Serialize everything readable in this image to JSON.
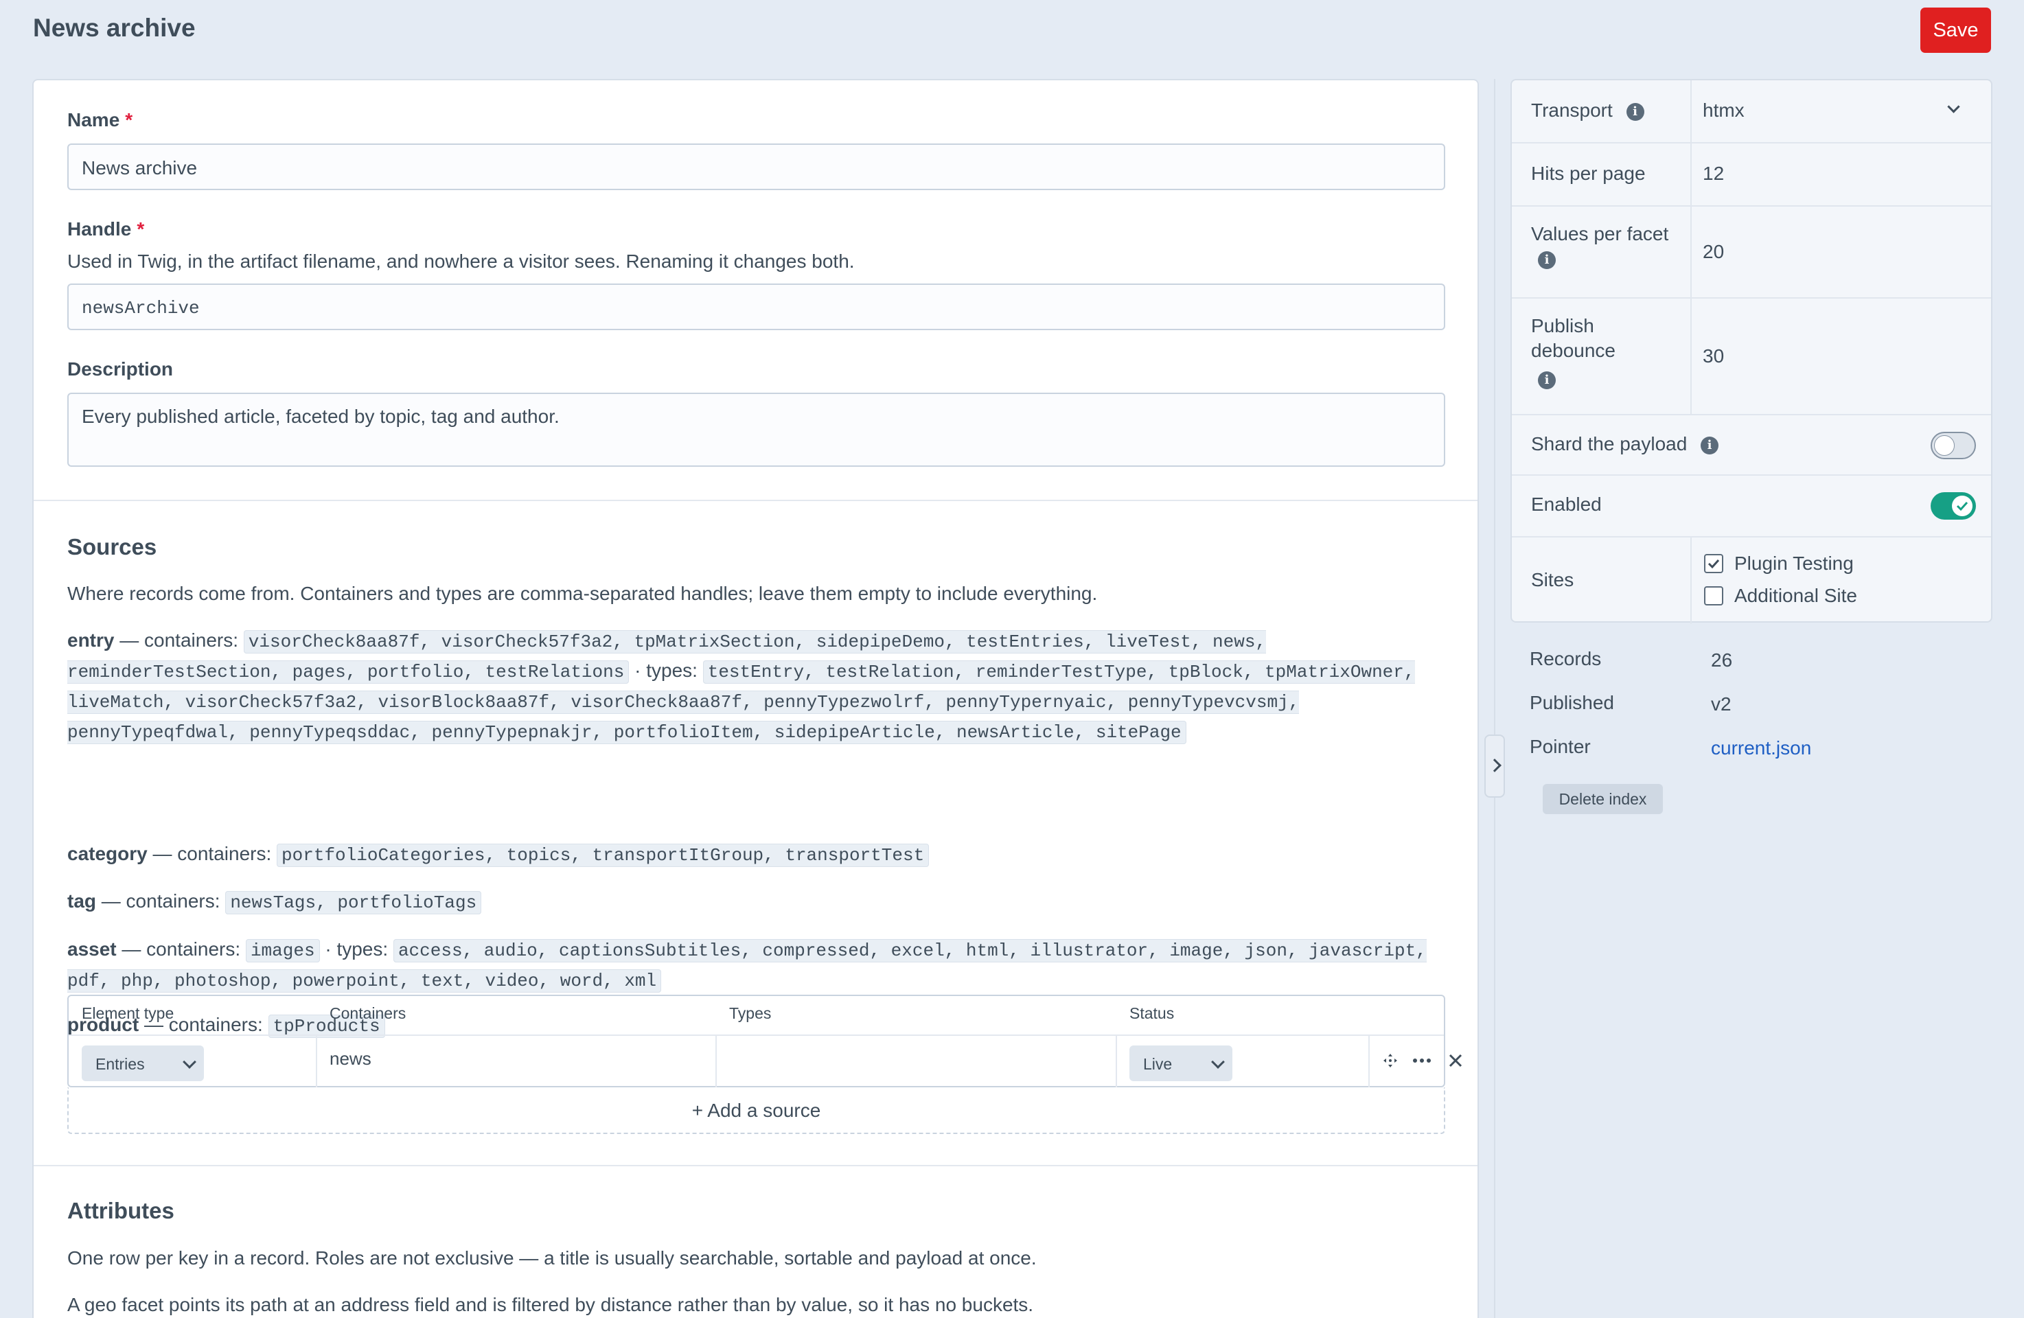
{
  "page": {
    "title": "News archive",
    "save_label": "Save"
  },
  "form": {
    "name_label": "Name",
    "name_value": "News archive",
    "handle_label": "Handle",
    "handle_help": "Used in Twig, in the artifact filename, and nowhere a visitor sees. Renaming it changes both.",
    "handle_value": "newsArchive",
    "description_label": "Description",
    "description_value": "Every published article, faceted by topic, tag and author.",
    "required_mark": "*"
  },
  "sources": {
    "heading": "Sources",
    "intro": "Where records come from. Containers and types are comma-separated handles; leave them empty to include everything.",
    "containers_text": "— containers:",
    "types_text": "· types:",
    "entry": {
      "name": "entry",
      "containers": "visorCheck8aa87f, visorCheck57f3a2, tpMatrixSection, sidepipeDemo, testEntries, liveTest, news, reminderTestSection, pages, portfolio, testRelations",
      "types": "testEntry, testRelation, reminderTestType, tpBlock, tpMatrixOwner, liveMatch, visorCheck57f3a2, visorBlock8aa87f, visorCheck8aa87f, pennyTypezwolrf, pennyTypernyaic, pennyTypevcvsmj, pennyTypeqfdwal, pennyTypeqsddac, pennyTypepnakjr, portfolioItem, sidepipeArticle, newsArticle, sitePage"
    },
    "category": {
      "name": "category",
      "containers": "portfolioCategories, topics, transportItGroup, transportTest"
    },
    "tag": {
      "name": "tag",
      "containers": "newsTags, portfolioTags"
    },
    "asset": {
      "name": "asset",
      "containers": "images",
      "types": "access, audio, captionsSubtitles, compressed, excel, html, illustrator, image, json, javascript, pdf, php, photoshop, powerpoint, text, video, word, xml"
    },
    "product": {
      "name": "product",
      "containers": "tpProducts"
    },
    "table": {
      "headers": [
        "Element type",
        "Containers",
        "Types",
        "Status"
      ],
      "row": {
        "element_type": "Entries",
        "containers": "news",
        "types": "",
        "status": "Live"
      }
    },
    "add_label": "Add a source"
  },
  "attributes": {
    "heading": "Attributes",
    "p1": "One row per key in a record. Roles are not exclusive — a title is usually searchable, sortable and payload at once.",
    "p2": "A geo facet points its path at an address field and is filtered by distance rather than by value, so it has no buckets."
  },
  "settings": {
    "transport_label": "Transport",
    "transport_value": "htmx",
    "hits_label": "Hits per page",
    "hits_value": "12",
    "values_label": "Values per facet",
    "values_value": "20",
    "debounce_label": "Publish debounce",
    "debounce_value": "30",
    "shard_label": "Shard the payload",
    "shard_on": false,
    "enabled_label": "Enabled",
    "enabled_on": true,
    "sites_label": "Sites",
    "sites": [
      {
        "label": "Plugin Testing",
        "checked": true
      },
      {
        "label": "Additional Site",
        "checked": false
      }
    ],
    "accent": "#16a085"
  },
  "meta": {
    "records_label": "Records",
    "records_value": "26",
    "published_label": "Published",
    "published_value": "v2",
    "pointer_label": "Pointer",
    "pointer_value": "current.json",
    "delete_label": "Delete index"
  }
}
